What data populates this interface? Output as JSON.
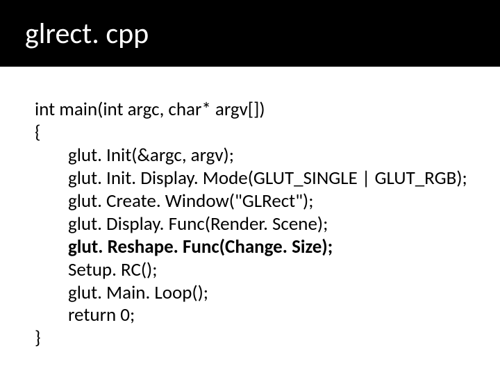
{
  "title": "glrect. cpp",
  "code": {
    "l1": "int main(int argc, char* argv[])",
    "l2": "{",
    "l3": "glut. Init(&argc, argv);",
    "l4": "glut. Init. Display. Mode(GLUT_SINGLE | GLUT_RGB);",
    "l5": "glut. Create. Window(\"GLRect\");",
    "l6": "glut. Display. Func(Render. Scene);",
    "l7": "glut. Reshape. Func(Change. Size);",
    "l8": "Setup. RC();",
    "l9": "glut. Main. Loop();",
    "l10": "return 0;",
    "l11": "}"
  }
}
